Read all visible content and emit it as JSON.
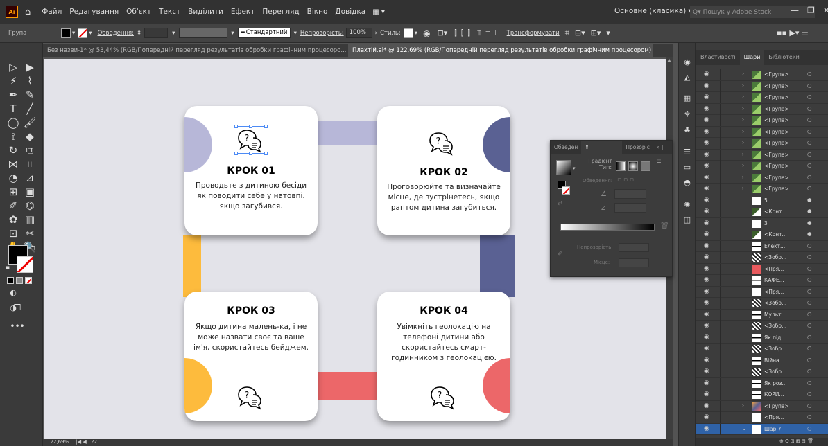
{
  "menubar": {
    "logo": "Ai",
    "items": [
      "Файл",
      "Редагування",
      "Об'єкт",
      "Текст",
      "Виділити",
      "Ефект",
      "Перегляд",
      "Вікно",
      "Довідка"
    ],
    "workspace": "Основне (класика)",
    "search_placeholder": "Пошук у Adobe Stock"
  },
  "controlbar": {
    "selection_label": "Група",
    "stroke_label": "Обведення:",
    "stroke_style": "Стандартний",
    "opacity_label": "Непрозорість:",
    "opacity_value": "100%",
    "style_label": "Стиль:",
    "transform_label": "Трансформувати"
  },
  "tabs": [
    {
      "label": "Без назви-1* @ 53,44% (RGB/Попередній перегляд результатів обробки графічним процесоро...",
      "active": false
    },
    {
      "label": "Плахтій.ai* @ 122,69% (RGB/Попередній перегляд результатів обробки графічним процесором)",
      "active": true
    }
  ],
  "colors": {
    "lavender": "#b7b7d8",
    "navy": "#5a6193",
    "yellow": "#fdbb3d",
    "coral": "#ec6769",
    "panel": "#3c3c3c"
  },
  "cards": [
    {
      "title": "КРОК 01",
      "body": "Проводьте з дитиною бесіди як поводити себе у натовпі. якщо загубився."
    },
    {
      "title": "КРОК 02",
      "body": "Проговорюйте та визначайте місце, де зустрінетесь, якщо раптом дитина загубиться."
    },
    {
      "title": "КРОК 03",
      "body": "Якщо дитина малень-ка, і не може назвати своє та ваше ім'я, скористайтесь бейджем."
    },
    {
      "title": "КРОК 04",
      "body": "Увімкніть геолокацію на телефоні дитини або скористайтесь смарт-годинником з геолокацією."
    }
  ],
  "gradient_panel": {
    "tabs": [
      "Обведен",
      "Градієнт",
      "Прозоріс"
    ],
    "type_label": "Тип:",
    "stroke_label": "Обведення:",
    "opacity_label": "Непрозорість:",
    "location_label": "Місце:"
  },
  "layers_panel": {
    "tabs": [
      "Властивості",
      "Шари",
      "Бібліотеки"
    ],
    "rows": [
      {
        "name": "<Група>",
        "expandable": true,
        "thumb": "group",
        "target": "○"
      },
      {
        "name": "<Група>",
        "expandable": true,
        "thumb": "group",
        "target": "○"
      },
      {
        "name": "<Група>",
        "expandable": true,
        "thumb": "group",
        "target": "○"
      },
      {
        "name": "<Група>",
        "expandable": true,
        "thumb": "group",
        "target": "○"
      },
      {
        "name": "<Група>",
        "expandable": true,
        "thumb": "group",
        "target": "○"
      },
      {
        "name": "<Група>",
        "expandable": true,
        "thumb": "group",
        "target": "○"
      },
      {
        "name": "<Група>",
        "expandable": true,
        "thumb": "group",
        "target": "○"
      },
      {
        "name": "<Група>",
        "expandable": true,
        "thumb": "group",
        "target": "○"
      },
      {
        "name": "<Група>",
        "expandable": true,
        "thumb": "group",
        "target": "○"
      },
      {
        "name": "<Група>",
        "expandable": true,
        "thumb": "group",
        "target": "○"
      },
      {
        "name": "<Група>",
        "expandable": true,
        "thumb": "group",
        "target": "○"
      },
      {
        "name": "5",
        "expandable": false,
        "thumb": "white",
        "target": "●"
      },
      {
        "name": "<Конт...",
        "expandable": false,
        "thumb": "contour",
        "target": "●"
      },
      {
        "name": "3",
        "expandable": false,
        "thumb": "white",
        "target": "●"
      },
      {
        "name": "<Конт...",
        "expandable": false,
        "thumb": "contour",
        "target": "●"
      },
      {
        "name": "Елект...",
        "expandable": false,
        "thumb": "line",
        "target": "○"
      },
      {
        "name": "<Зобр...",
        "expandable": false,
        "thumb": "pattern",
        "target": "○"
      },
      {
        "name": "<Пря...",
        "expandable": false,
        "thumb": "red",
        "target": "○"
      },
      {
        "name": "КАФЕ...",
        "expandable": false,
        "thumb": "line",
        "target": "○"
      },
      {
        "name": "<Пря...",
        "expandable": false,
        "thumb": "white",
        "target": "○"
      },
      {
        "name": "<Зобр...",
        "expandable": false,
        "thumb": "pattern",
        "target": "○"
      },
      {
        "name": "Мульт...",
        "expandable": false,
        "thumb": "line",
        "target": "○"
      },
      {
        "name": "<Зобр...",
        "expandable": false,
        "thumb": "pattern",
        "target": "○"
      },
      {
        "name": "Як під...",
        "expandable": false,
        "thumb": "line",
        "target": "○"
      },
      {
        "name": "<Зобр...",
        "expandable": false,
        "thumb": "pattern",
        "target": "○"
      },
      {
        "name": "Війна ...",
        "expandable": false,
        "thumb": "line",
        "target": "○"
      },
      {
        "name": "<Зобр...",
        "expandable": false,
        "thumb": "pattern",
        "target": "○"
      },
      {
        "name": "Як роз...",
        "expandable": false,
        "thumb": "line",
        "target": "○"
      },
      {
        "name": "КОРИ...",
        "expandable": false,
        "thumb": "line",
        "target": "○"
      },
      {
        "name": "<Група>",
        "expandable": true,
        "thumb": "colorful",
        "target": "○"
      },
      {
        "name": "<Пря...",
        "expandable": false,
        "thumb": "white",
        "target": "○"
      },
      {
        "name": "Шар 7",
        "expandable": true,
        "thumb": "layer",
        "target": "○"
      }
    ]
  },
  "statusbar": {
    "zoom": "122,69%",
    "page": "22"
  }
}
